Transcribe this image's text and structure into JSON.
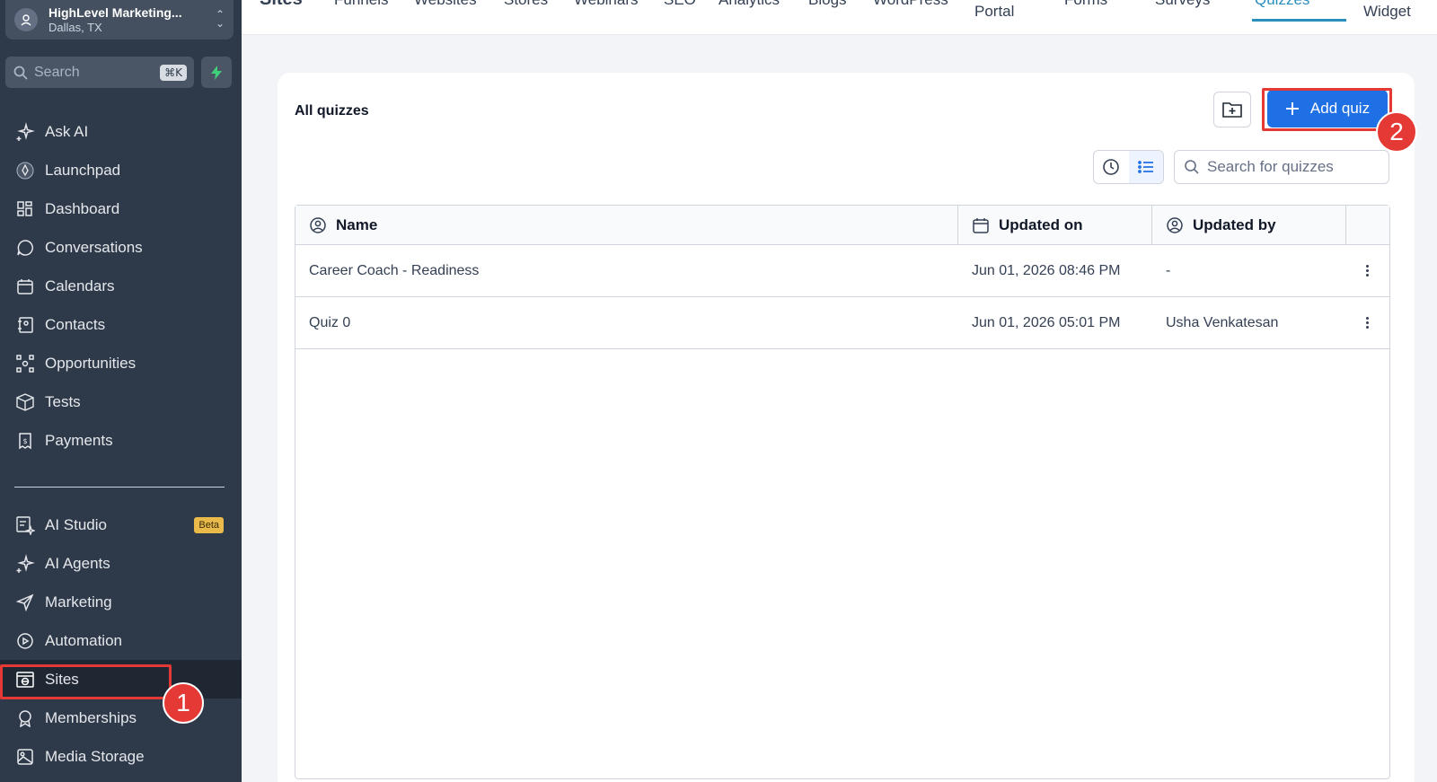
{
  "account": {
    "name": "HighLevel Marketing...",
    "location": "Dallas, TX"
  },
  "search": {
    "placeholder": "Search",
    "shortcut": "⌘K"
  },
  "sidebar": {
    "items": [
      {
        "label": "Ask AI",
        "icon": "sparkle-icon"
      },
      {
        "label": "Launchpad",
        "icon": "rocket-icon"
      },
      {
        "label": "Dashboard",
        "icon": "grid-icon"
      },
      {
        "label": "Conversations",
        "icon": "chat-icon"
      },
      {
        "label": "Calendars",
        "icon": "calendar-icon"
      },
      {
        "label": "Contacts",
        "icon": "contacts-icon"
      },
      {
        "label": "Opportunities",
        "icon": "network-icon"
      },
      {
        "label": "Tests",
        "icon": "cube-icon"
      },
      {
        "label": "Payments",
        "icon": "receipt-icon"
      }
    ],
    "items2": [
      {
        "label": "AI Studio",
        "icon": "ai-studio-icon",
        "badge": "Beta"
      },
      {
        "label": "AI Agents",
        "icon": "sparkle-icon"
      },
      {
        "label": "Marketing",
        "icon": "send-icon"
      },
      {
        "label": "Automation",
        "icon": "play-circle-icon"
      },
      {
        "label": "Sites",
        "icon": "globe-window-icon",
        "active": true
      },
      {
        "label": "Memberships",
        "icon": "award-icon"
      },
      {
        "label": "Media Storage",
        "icon": "image-icon"
      }
    ]
  },
  "topbar": {
    "tabs": [
      "Sites",
      "Funnels",
      "Websites",
      "Stores",
      "Webinars",
      "SEO",
      "Analytics",
      "Blogs",
      "WordPress",
      "Client Portal",
      "Forms",
      "Surveys",
      "Quizzes",
      "Chat Widget"
    ],
    "portal_label": "Portal",
    "widget_label": "Widget",
    "active": "Quizzes"
  },
  "main": {
    "title": "All quizzes",
    "add_label": "Add quiz",
    "search_placeholder": "Search for quizzes",
    "columns": {
      "name": "Name",
      "updated_on": "Updated on",
      "updated_by": "Updated by"
    },
    "rows": [
      {
        "name": "Career Coach - Readiness",
        "updated_on": "Jun 01, 2026 08:46 PM",
        "updated_by": "-"
      },
      {
        "name": "Quiz 0",
        "updated_on": "Jun 01, 2026 05:01 PM",
        "updated_by": "Usha Venkatesan"
      }
    ]
  },
  "annotations": {
    "step1": "1",
    "step2": "2"
  },
  "colors": {
    "sidebar": "#2e3a4a",
    "primary": "#1f6fe5",
    "highlight": "#e53935",
    "beta": "#e9b949"
  }
}
